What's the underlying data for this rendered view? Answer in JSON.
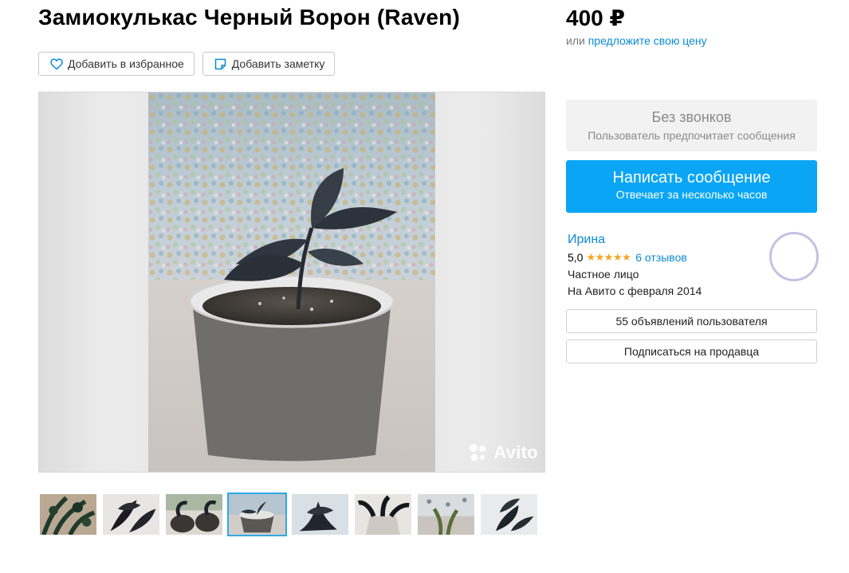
{
  "listing": {
    "title": "Замиокулькас Черный Ворон (Raven)",
    "price": "400 ₽",
    "offer_prefix": "или",
    "offer_link": "предложите свою цену"
  },
  "actions": {
    "favorite_label": "Добавить в избранное",
    "note_label": "Добавить заметку"
  },
  "gallery": {
    "watermark": "Avito",
    "thumbnail_count": 8,
    "active_thumbnail": 4
  },
  "contact": {
    "no_calls_title": "Без звонков",
    "no_calls_subtitle": "Пользователь предпочитает сообщения",
    "message_button_title": "Написать сообщение",
    "message_button_subtitle": "Отвечает за несколько часов"
  },
  "seller": {
    "name": "Ирина",
    "rating": "5,0",
    "stars": "★★★★★",
    "reviews": "6 отзывов",
    "type": "Частное лицо",
    "since": "На Авито с февраля 2014",
    "listings_button": "55 объявлений пользователя",
    "subscribe_button": "Подписаться на продавца"
  },
  "colors": {
    "accent": "#0aa6f5",
    "link": "#0a8ad6",
    "star": "#f5a623",
    "active_thumb_border": "#2fa9e8"
  },
  "icons": [
    "heart-icon",
    "note-icon",
    "avito-logo-icon"
  ]
}
